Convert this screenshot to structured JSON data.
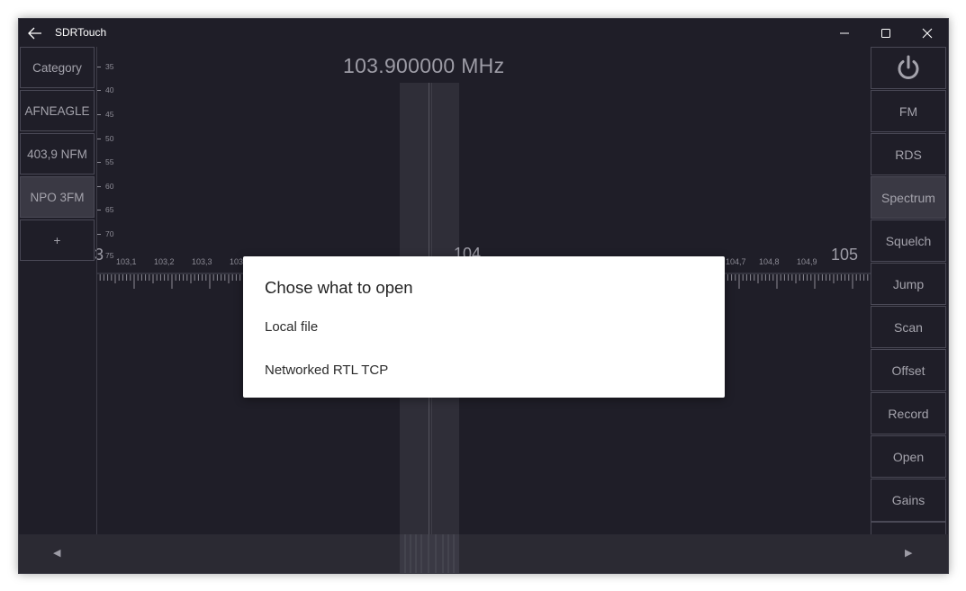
{
  "window": {
    "title": "SDRTouch",
    "controls": {
      "minimize": "minimize",
      "maximize": "maximize",
      "close": "close"
    }
  },
  "frequency": {
    "display": "103.900000 MHz"
  },
  "left_sidebar": {
    "items": [
      {
        "label": "Category",
        "active": false
      },
      {
        "label": "AFNEAGLE",
        "active": false
      },
      {
        "label": "403,9 NFM",
        "active": false
      },
      {
        "label": "NPO 3FM",
        "active": true
      },
      {
        "label": "+",
        "active": false
      }
    ]
  },
  "right_sidebar": {
    "power_icon": "power-icon",
    "items": [
      {
        "label": "FM",
        "active": false
      },
      {
        "label": "RDS",
        "active": false
      },
      {
        "label": "Spectrum",
        "active": true
      },
      {
        "label": "Squelch",
        "active": false
      },
      {
        "label": "Jump",
        "active": false
      },
      {
        "label": "Scan",
        "active": false
      },
      {
        "label": "Offset",
        "active": false
      },
      {
        "label": "Record",
        "active": false
      },
      {
        "label": "Open",
        "active": false
      },
      {
        "label": "Gains",
        "active": false
      }
    ]
  },
  "db_scale": [
    "35",
    "40",
    "45",
    "50",
    "55",
    "60",
    "65",
    "70",
    "75"
  ],
  "freq_axis": {
    "major_left_partial": "3",
    "major_center": "104",
    "major_right": "105",
    "minor_left": [
      "103,1",
      "103,2",
      "103,3",
      "103"
    ],
    "minor_right": [
      "104,7",
      "104,8",
      "104,9"
    ]
  },
  "bottom_nav": {
    "left_arrow": "◀",
    "right_arrow": "▶"
  },
  "dialog": {
    "title": "Chose what to open",
    "options": [
      "Local file",
      "Networked RTL TCP"
    ]
  },
  "colors": {
    "background": "#1f1e28",
    "button_border": "#4a4956",
    "active_button": "#3a3944",
    "text_muted": "#a4a3ac",
    "dialog_bg": "#ffffff"
  }
}
